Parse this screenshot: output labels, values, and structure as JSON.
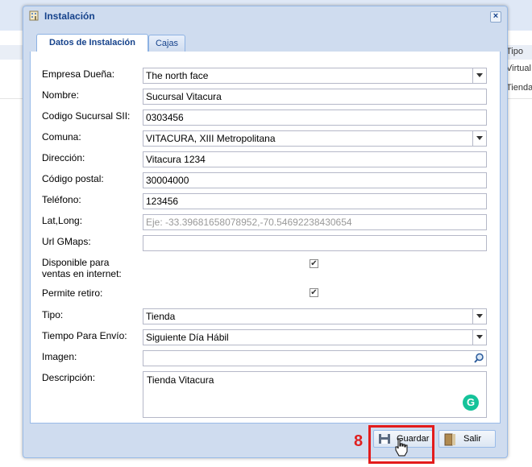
{
  "background": {
    "column_header": "Tipo",
    "rows": [
      "Virtual",
      "Tienda"
    ]
  },
  "window": {
    "title": "Instalación",
    "close_icon": "close-icon",
    "tabs": [
      {
        "label": "Datos de Instalación",
        "active": true
      },
      {
        "label": "Cajas",
        "active": false
      }
    ]
  },
  "form": {
    "empresa": {
      "label": "Empresa Dueña:",
      "value": "The north face"
    },
    "nombre": {
      "label": "Nombre:",
      "value": "Sucursal Vitacura"
    },
    "codigo_sii": {
      "label": "Codigo Sucursal SII:",
      "value": "0303456"
    },
    "comuna": {
      "label": "Comuna:",
      "value": "VITACURA, XIII Metropolitana"
    },
    "direccion": {
      "label": "Dirección:",
      "value": "Vitacura 1234"
    },
    "codigo_postal": {
      "label": "Código postal:",
      "value": "30004000"
    },
    "telefono": {
      "label": "Teléfono:",
      "value": "123456"
    },
    "latlong": {
      "label": "Lat,Long:",
      "value": "",
      "placeholder": "Eje: -33.39681658078952,-70.54692238430654"
    },
    "url_gmaps": {
      "label": "Url GMaps:",
      "value": ""
    },
    "disponible": {
      "label_line1": "Disponible para",
      "label_line2": "ventas en internet:",
      "checked": true
    },
    "permite_retiro": {
      "label": "Permite retiro:",
      "checked": true
    },
    "tipo": {
      "label": "Tipo:",
      "value": "Tienda"
    },
    "tiempo_envio": {
      "label": "Tiempo Para Envío:",
      "value": "Siguiente Día Hábil"
    },
    "imagen": {
      "label": "Imagen:",
      "value": ""
    },
    "descripcion": {
      "label": "Descripción:",
      "value": "Tienda Vitacura"
    }
  },
  "buttons": {
    "guardar": "Guardar",
    "salir": "Salir"
  },
  "annotation": {
    "step_number": "8",
    "highlight_color": "#e31c1c"
  },
  "colors": {
    "window_bg": "#cfdcef",
    "title_text": "#15428b",
    "grammarly": "#15c39a"
  }
}
